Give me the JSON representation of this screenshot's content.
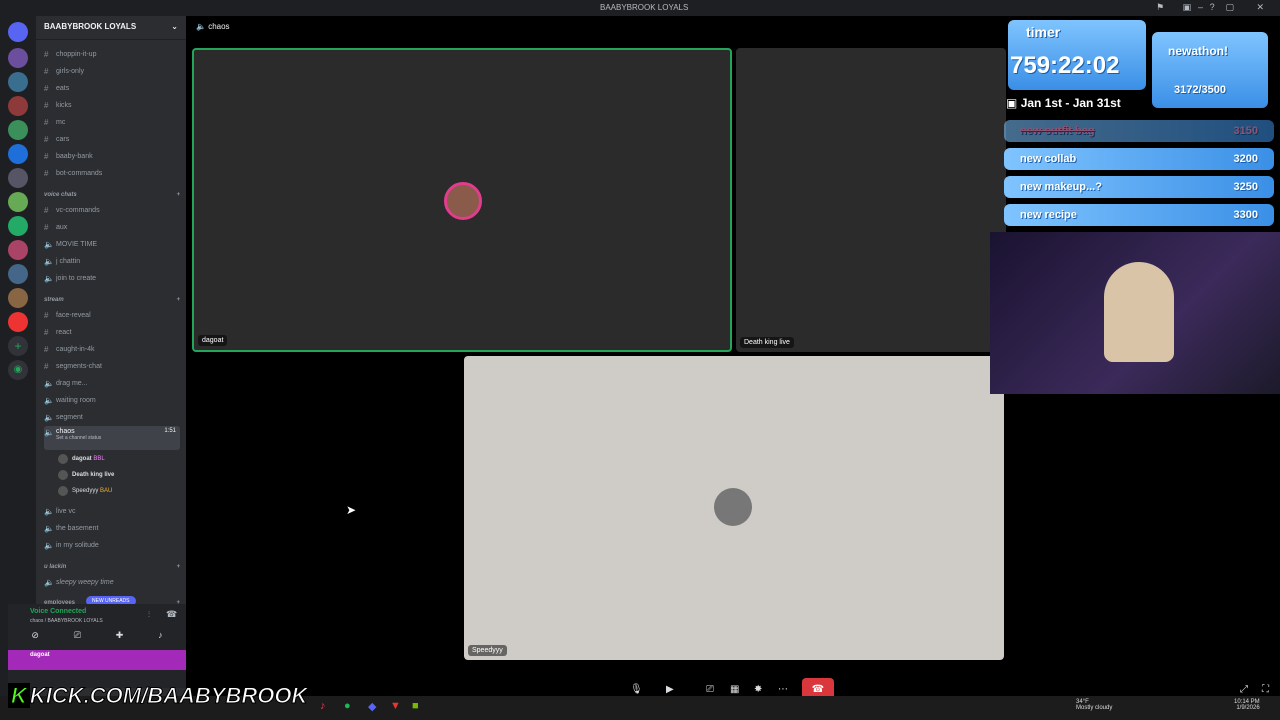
{
  "window": {
    "title": "BAABYBROOK LOYALS"
  },
  "guild": {
    "name": "BAABYBROOK LOYALS"
  },
  "header": {
    "channel": "chaos"
  },
  "channels": [
    {
      "name": "choppin-it-up",
      "type": "text"
    },
    {
      "name": "girls-only",
      "type": "text"
    },
    {
      "name": "eats",
      "type": "text"
    },
    {
      "name": "kicks",
      "type": "text"
    },
    {
      "name": "mc",
      "type": "text"
    },
    {
      "name": "cars",
      "type": "text"
    },
    {
      "name": "baaby-bank",
      "type": "text"
    },
    {
      "name": "bot-commands",
      "type": "text"
    }
  ],
  "cat_voice": "voice chats",
  "voice_channels": [
    {
      "name": "vc-commands",
      "type": "text"
    },
    {
      "name": "aux",
      "type": "text"
    },
    {
      "name": "MOVIE TIME",
      "type": "voice"
    },
    {
      "name": "j chattin",
      "type": "voice"
    },
    {
      "name": "join to create",
      "type": "voice"
    }
  ],
  "cat_stream": "stream",
  "stream_channels": [
    {
      "name": "face-reveal",
      "type": "text"
    },
    {
      "name": "react",
      "type": "text"
    },
    {
      "name": "caught-in-4k",
      "type": "text"
    },
    {
      "name": "segments-chat",
      "type": "text"
    },
    {
      "name": "drag me...",
      "type": "voice"
    },
    {
      "name": "waiting room",
      "type": "voice"
    },
    {
      "name": "segment",
      "type": "voice"
    }
  ],
  "active_channel": {
    "name": "chaos",
    "time": "1:51",
    "status": "Set a channel status"
  },
  "voice_users": [
    {
      "name": "dagoat",
      "tag": "BBL"
    },
    {
      "name": "Death king live",
      "tag": ""
    },
    {
      "name": "Speedyyy",
      "tag": "BAU"
    }
  ],
  "more_channels": [
    {
      "name": "live vc"
    },
    {
      "name": "the basement"
    },
    {
      "name": "in my solitude"
    }
  ],
  "cat_u": "u lackin",
  "u_channels": [
    {
      "name": "sleepy weepy time"
    }
  ],
  "cat_employees": "employees",
  "new_unreads": "NEW UNREADS",
  "voice_status": {
    "label": "Voice Connected",
    "sub": "chaos / BAABYBROOK LOYALS"
  },
  "user": {
    "name": "dagoat"
  },
  "tiles": [
    {
      "name": "dagoat"
    },
    {
      "name": "Death king live"
    },
    {
      "name": "Speedyyy"
    }
  ],
  "overlay": {
    "timer_label": "timer",
    "timer": "759:22:02",
    "dates": "Jan 1st - Jan 31st",
    "subathon_label": "newathon!",
    "subathon_count": "3172/3500",
    "goals": [
      {
        "label": "new outfit bag",
        "value": "3150"
      },
      {
        "label": "new collab",
        "value": "3200"
      },
      {
        "label": "new makeup...?",
        "value": "3250"
      },
      {
        "label": "new recipe",
        "value": "3300"
      }
    ],
    "kick_url": "KICK.COM/BAABYBROOK"
  },
  "taskbar": {
    "weather": "34°F",
    "weather_desc": "Mostly cloudy",
    "time": "10:14 PM",
    "date": "1/9/2026"
  }
}
